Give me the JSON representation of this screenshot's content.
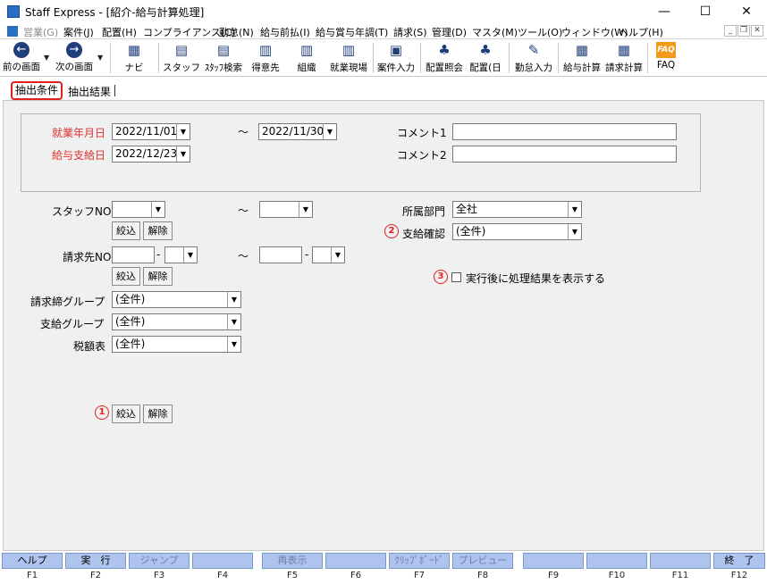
{
  "window": {
    "title": "Staff Express - [紹介-給与計算処理]",
    "min": "—",
    "max": "☐",
    "close": "✕"
  },
  "menu": [
    "営業(G)",
    "案件(J)",
    "配置(H)",
    "コンプライアンス(C)",
    "勤怠(N)",
    "給与前払(I)",
    "給与賞与年調(T)",
    "請求(S)",
    "管理(D)",
    "マスタ(M)",
    "ツール(O)",
    "ウィンドウ(W)",
    "ヘルプ(H)"
  ],
  "mdi": {
    "min": "_",
    "restore": "❐",
    "close": "✕"
  },
  "toolbar": [
    {
      "label": "前の画面",
      "icon": "back-arrow-icon",
      "glyph": "←"
    },
    {
      "label": "次の画面",
      "icon": "forward-arrow-icon",
      "glyph": "→"
    },
    {
      "label": "ナビ",
      "icon": "navi-icon",
      "glyph": "▦"
    },
    {
      "label": "スタッフ",
      "icon": "staff-icon",
      "glyph": "▤"
    },
    {
      "label": "ｽﾀｯﾌ検索",
      "icon": "staff-search-icon",
      "glyph": "▤"
    },
    {
      "label": "得意先",
      "icon": "customer-icon",
      "glyph": "▥"
    },
    {
      "label": "組織",
      "icon": "organization-icon",
      "glyph": "▥"
    },
    {
      "label": "就業現場",
      "icon": "worksite-icon",
      "glyph": "▥"
    },
    {
      "label": "案件入力",
      "icon": "case-input-icon",
      "glyph": "▣"
    },
    {
      "label": "配置照会",
      "icon": "placement-inquiry-icon",
      "glyph": "♣"
    },
    {
      "label": "配置(日",
      "icon": "placement-day-icon",
      "glyph": "♣"
    },
    {
      "label": "勤怠入力",
      "icon": "attendance-input-icon",
      "glyph": "✎"
    },
    {
      "label": "給与計算",
      "icon": "payroll-calc-icon",
      "glyph": "▦"
    },
    {
      "label": "請求計算",
      "icon": "billing-calc-icon",
      "glyph": "▦"
    },
    {
      "label": "FAQ",
      "icon": "faq-icon",
      "glyph": "FAQ"
    }
  ],
  "tabs": {
    "t1": "抽出条件",
    "t2": "抽出結果"
  },
  "form": {
    "work_date_label": "就業年月日",
    "work_date_from": "2022/11/01",
    "work_date_to": "2022/11/30",
    "pay_date_label": "給与支給日",
    "pay_date": "2022/12/23",
    "comment1_label": "コメント1",
    "comment2_label": "コメント2",
    "tilde": "～",
    "staff_no_label": "スタッフNO",
    "customer_no_label": "請求先NO",
    "dash": "-",
    "dept_label": "所属部門",
    "dept_value": "全社",
    "pay_confirm_label": "支給確認",
    "pay_confirm_value": "(全件)",
    "show_result_label": "実行後に処理結果を表示する",
    "billing_group_label": "請求締グループ",
    "billing_group_value": "(全件)",
    "pay_group_label": "支給グループ",
    "pay_group_value": "(全件)",
    "tax_table_label": "税額表",
    "tax_table_value": "(全件)",
    "filter_btn": "絞込",
    "clear_btn": "解除",
    "marker1": "1",
    "marker2": "2",
    "marker3": "3"
  },
  "fkeys": [
    {
      "label": "ヘルプ",
      "key": "F1",
      "enabled": true
    },
    {
      "label": "実　行",
      "key": "F2",
      "enabled": true
    },
    {
      "label": "ジャンプ",
      "key": "F3",
      "enabled": false
    },
    {
      "label": "",
      "key": "F4",
      "enabled": false
    },
    {
      "label": "再表示",
      "key": "F5",
      "enabled": false
    },
    {
      "label": "",
      "key": "F6",
      "enabled": false
    },
    {
      "label": "ｸﾘｯﾌﾟﾎﾞｰﾄﾞ",
      "key": "F7",
      "enabled": false
    },
    {
      "label": "プレビュー",
      "key": "F8",
      "enabled": false
    },
    {
      "label": "",
      "key": "F9",
      "enabled": false
    },
    {
      "label": "",
      "key": "F10",
      "enabled": false
    },
    {
      "label": "",
      "key": "F11",
      "enabled": false
    },
    {
      "label": "終　了",
      "key": "F12",
      "enabled": true
    }
  ]
}
